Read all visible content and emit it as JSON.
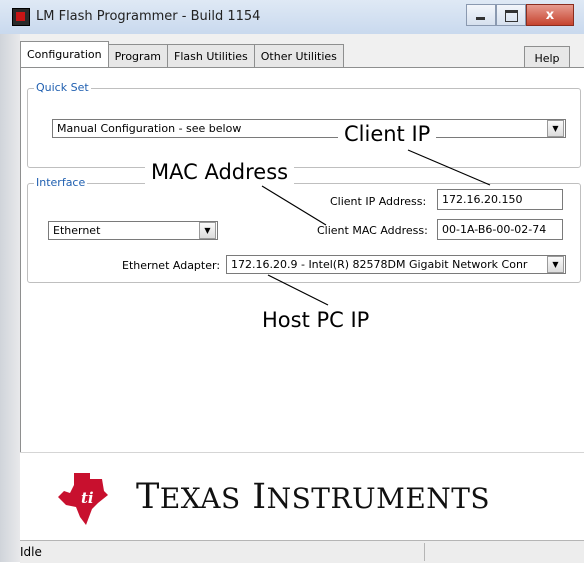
{
  "window": {
    "title": "LM Flash Programmer - Build 1154",
    "close_glyph": "x"
  },
  "tabs": [
    {
      "label": "Configuration",
      "active": true
    },
    {
      "label": "Program",
      "active": false
    },
    {
      "label": "Flash Utilities",
      "active": false
    },
    {
      "label": "Other Utilities",
      "active": false
    }
  ],
  "help_tab": {
    "label": "Help"
  },
  "quick_set": {
    "label": "Quick Set",
    "value": "Manual Configuration - see below"
  },
  "interface": {
    "label": "Interface",
    "type_value": "Ethernet",
    "client_ip_label": "Client IP Address:",
    "client_ip_value": "172.16.20.150",
    "client_mac_label": "Client MAC Address:",
    "client_mac_value": "00-1A-B6-00-02-74",
    "adapter_label": "Ethernet Adapter:",
    "adapter_value": "172.16.20.9 - Intel(R) 82578DM Gigabit Network Conr"
  },
  "callouts": {
    "client_ip": "Client IP",
    "mac_address": "MAC Address",
    "host_pc_ip": "Host PC IP"
  },
  "logo": {
    "text_first": "T",
    "text_first_rest": "EXAS",
    "text_second": "I",
    "text_second_rest": "NSTRUMENTS",
    "brand_color": "#c8102e"
  },
  "status": {
    "text": "Idle"
  }
}
